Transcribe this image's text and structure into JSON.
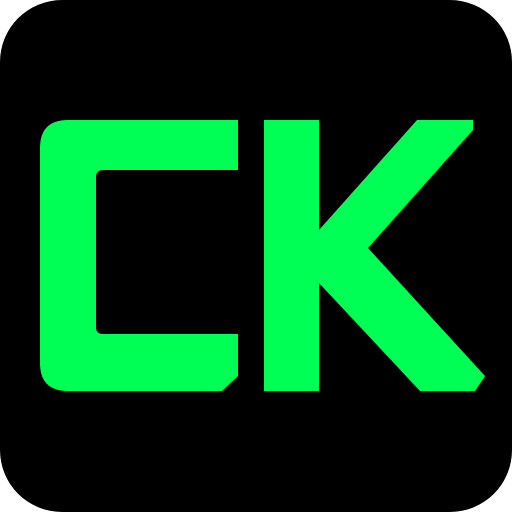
{
  "app_icon": {
    "monogram": "CK",
    "background_color": "#000000",
    "glyph_color": "#00FF55",
    "shape": "rounded-square"
  }
}
